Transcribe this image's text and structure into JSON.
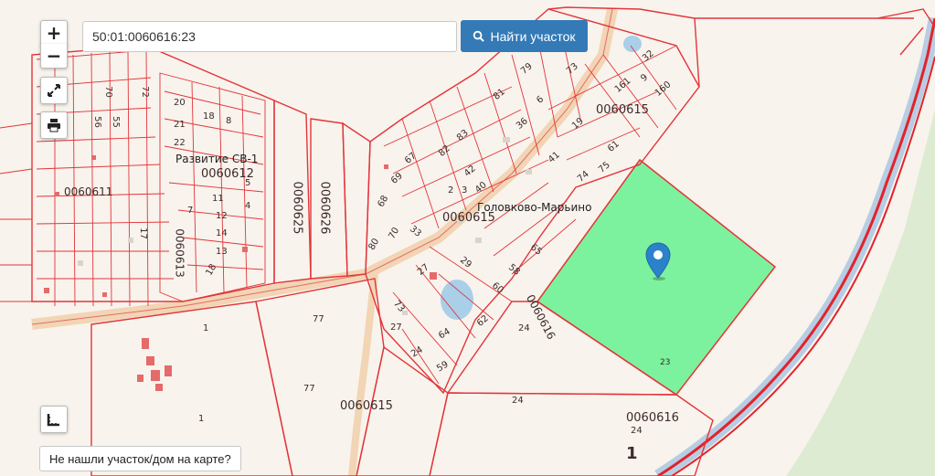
{
  "search": {
    "value": "50:01:0060616:23",
    "button_label": "Найти участок"
  },
  "controls": {
    "zoom_in": "+",
    "zoom_out": "−"
  },
  "not_found_link": "Не нашли участок/дом на карте?",
  "blocks": [
    "0060615",
    "0060612",
    "0060611",
    "0060613",
    "0060625",
    "0060626",
    "0060616"
  ],
  "places": [
    "Головково-Марьино",
    "Развитие СВ-1"
  ],
  "parcels": [
    "23",
    "24",
    "1",
    "77",
    "20",
    "18",
    "8",
    "21",
    "22",
    "12",
    "14",
    "11",
    "4",
    "13",
    "5",
    "7",
    "81",
    "67",
    "82",
    "69",
    "68",
    "70",
    "80",
    "33",
    "29",
    "65",
    "58",
    "60",
    "62",
    "64",
    "59",
    "24",
    "27",
    "61",
    "73",
    "75",
    "74",
    "160",
    "9",
    "32",
    "161",
    "79",
    "73",
    "19",
    "42",
    "40",
    "2",
    "3",
    "41",
    "36",
    "6",
    "83",
    "27",
    "55",
    "56",
    "72",
    "70",
    "18",
    "17"
  ],
  "accent": "#337ab7",
  "highlight": "#7cf29e"
}
